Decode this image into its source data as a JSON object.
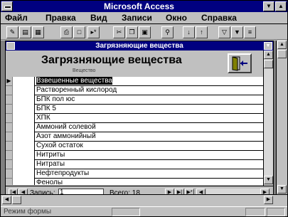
{
  "window": {
    "title": "Microsoft Access"
  },
  "menu": [
    "Файл",
    "Правка",
    "Вид",
    "Записи",
    "Окно",
    "Справка"
  ],
  "form": {
    "window_title": "Загрязняющие вещества",
    "header_title": "Загрязняющие вещества",
    "header_caption": "Вещество"
  },
  "records": [
    {
      "value": "Взвешенные вещества",
      "selected": true
    },
    {
      "value": "Растворенный кислород"
    },
    {
      "value": "БПК пол юс"
    },
    {
      "value": "БПК 5"
    },
    {
      "value": "ХПК"
    },
    {
      "value": "Аммоний солевой"
    },
    {
      "value": "Азот аммонийный"
    },
    {
      "value": "Сухой остаток"
    },
    {
      "value": "Нитриты"
    },
    {
      "value": "Нитраты"
    },
    {
      "value": "Нефтепродукты"
    },
    {
      "value": "Фенолы"
    }
  ],
  "navigation": {
    "record_label": "Запись:",
    "current_record": "1",
    "total_label": "Всего: 18"
  },
  "status": {
    "text": "Режим формы"
  },
  "colors": {
    "titlebar": "#000080",
    "face": "#c0c0c0",
    "workspace": "#808080"
  },
  "icons": {
    "toolbar": [
      "design-view-icon",
      "form-view-icon",
      "datasheet-view-icon",
      "print-icon",
      "print-preview-icon",
      "new-record-icon",
      "cut-icon",
      "copy-icon",
      "paste-icon",
      "find-icon",
      "sort-ascending-icon",
      "sort-descending-icon",
      "filter-by-form-icon",
      "apply-filter-icon",
      "remove-filter-icon"
    ]
  }
}
